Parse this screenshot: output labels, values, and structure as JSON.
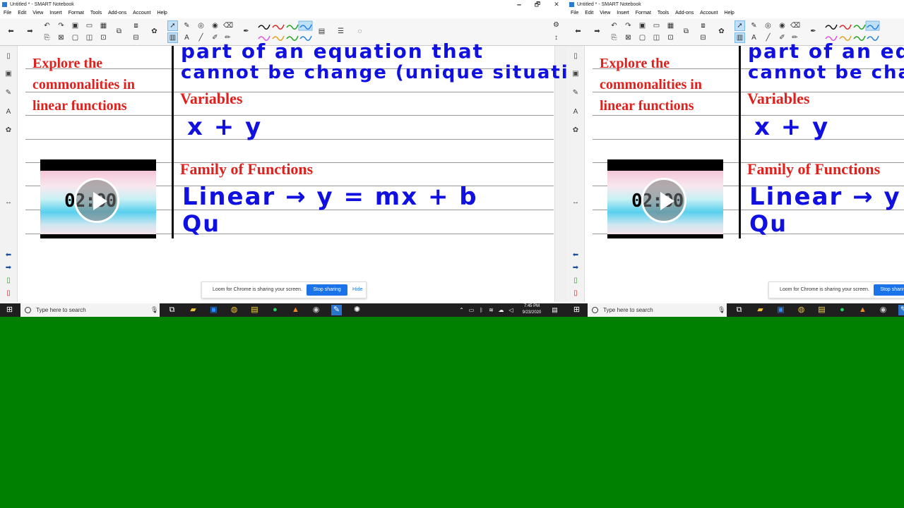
{
  "window": {
    "title": "Untitled * - SMART Notebook",
    "minimize": "🗕",
    "restore": "🗗",
    "close": "✕"
  },
  "menu": [
    "File",
    "Edit",
    "View",
    "Insert",
    "Format",
    "Tools",
    "Add-ons",
    "Account",
    "Help"
  ],
  "toolbar": {
    "left_icons": [
      "back-arrow-icon",
      "forward-arrow-icon",
      "undo-icon",
      "redo-icon",
      "save-icon",
      "table-icon",
      "screen-shade-icon",
      "delete-icon",
      "capture-icon",
      "document-camera-icon",
      "paste-icon",
      "fullscreen-icon",
      "select-icon",
      "pen-icon",
      "shapes-icon",
      "fill-icon",
      "eraser-icon",
      "text-icon",
      "line-icon",
      "magic-pen-icon"
    ],
    "pen_colors": [
      "#111111",
      "#e02020",
      "#20a020",
      "#2080e0",
      "#e050e0",
      "#e0a020"
    ],
    "selected_pen_color": "#2080e0"
  },
  "content": {
    "heading_lines": [
      "Explore the",
      "commonalities in",
      "linear functions"
    ],
    "handwritten_line1": "part of an equation that",
    "handwritten_line2": "cannot be change (unique situation)",
    "variables_label": "Variables",
    "variables_value": "x + y",
    "family_label": "Family of Functions",
    "linear_line": "Linear → y = mx + b",
    "partial_line": "Qu",
    "video_time": "02:00"
  },
  "loom": {
    "message": "Loom for Chrome is sharing your screen.",
    "stop_label": "Stop sharing",
    "hide_label": "Hide"
  },
  "taskbar": {
    "search_placeholder": "Type here to search",
    "time": "7:45 PM",
    "date": "9/23/2020",
    "apps": [
      "task-view-icon",
      "file-explorer-icon",
      "zoom-icon",
      "chrome-icon",
      "sticky-notes-icon",
      "spotify-icon",
      "vlc-icon",
      "obs-icon",
      "smart-notebook-icon",
      "loom-icon"
    ]
  }
}
